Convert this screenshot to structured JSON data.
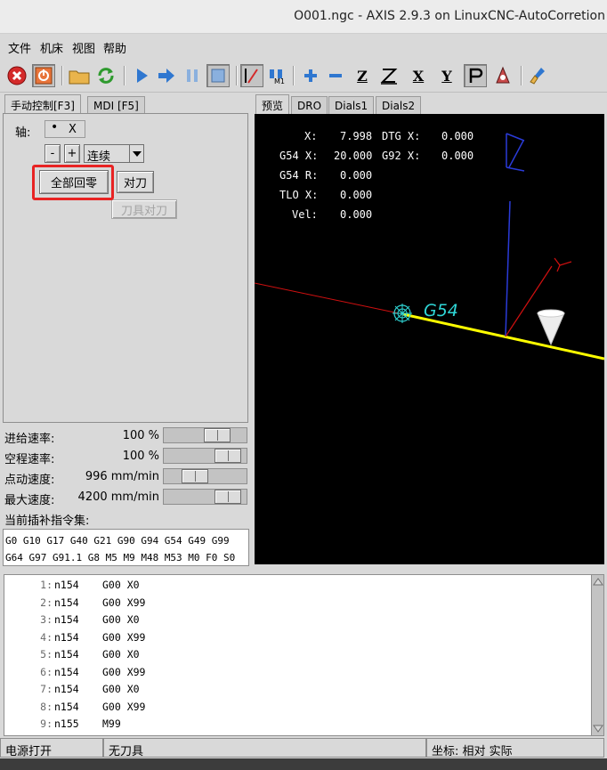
{
  "window": {
    "title": "O001.ngc - AXIS 2.9.3 on LinuxCNC-AutoCorretion"
  },
  "menu": {
    "file": "文件",
    "machine": "机床",
    "view": "视图",
    "help": "帮助"
  },
  "toolbar": {
    "axis_x": "X",
    "axis_y": "Y",
    "axis_z": "Z"
  },
  "left_tabs": {
    "manual": "手动控制[F3]",
    "mdi": "MDI [F5]"
  },
  "manual": {
    "axis_label": "轴:",
    "axis_value": "X",
    "minus": "-",
    "plus": "+",
    "jog_mode": "连续",
    "home_all": "全部回零",
    "touch_off": "对刀",
    "tool_touch_off": "刀具对刀"
  },
  "overrides": [
    {
      "label": "进给速率:",
      "value": "100 %",
      "level": 0.72
    },
    {
      "label": "空程速率:",
      "value": "100 %",
      "level": 0.9
    },
    {
      "label": "点动速度:",
      "value": "996 mm/min",
      "level": 0.32
    },
    {
      "label": "最大速度:",
      "value": "4200 mm/min",
      "level": 0.9
    }
  ],
  "active_gcodes": {
    "label": "当前插补指令集:",
    "line1": "G0 G10 G17 G40 G21 G90 G94 G54 G49 G99",
    "line2": "G64 G97 G91.1 G8 M5 M9 M48 M53 M0 F0 S0"
  },
  "preview_tabs": {
    "preview": "预览",
    "dro": "DRO",
    "dials1": "Dials1",
    "dials2": "Dials2"
  },
  "dro": {
    "row1_label": "X:",
    "row1_value": "7.998",
    "row1_dtg_label": "DTG X:",
    "row1_dtg_value": "0.000",
    "row2_label": "G54 X:",
    "row2_value": "20.000",
    "row2_g92_label": "G92 X:",
    "row2_g92_value": "0.000",
    "row3_label": "G54 R:",
    "row3_value": "0.000",
    "row4_label": "TLO X:",
    "row4_value": "0.000",
    "row5_label": "Vel:",
    "row5_value": "0.000"
  },
  "scene": {
    "z_label": "Z",
    "y_label": "Y",
    "origin_label": "G54"
  },
  "program": {
    "lines": [
      {
        "num": "1:",
        "code": "n154",
        "cmd": "G00 X0"
      },
      {
        "num": "2:",
        "code": "n154",
        "cmd": "G00 X99"
      },
      {
        "num": "3:",
        "code": "n154",
        "cmd": "G00 X0"
      },
      {
        "num": "4:",
        "code": "n154",
        "cmd": "G00 X99"
      },
      {
        "num": "5:",
        "code": "n154",
        "cmd": "G00 X0"
      },
      {
        "num": "6:",
        "code": "n154",
        "cmd": "G00 X99"
      },
      {
        "num": "7:",
        "code": "n154",
        "cmd": "G00 X0"
      },
      {
        "num": "8:",
        "code": "n154",
        "cmd": "G00 X99"
      },
      {
        "num": "9:",
        "code": "n155",
        "cmd": "M99"
      }
    ]
  },
  "status": {
    "power": "电源打开",
    "tool": "无刀具",
    "coords": "坐标: 相对 实际"
  },
  "colors": {
    "highlight": "#e82323",
    "path": "#ffff00",
    "axis_x": "#d01010",
    "axis_z": "#2a3bd8",
    "dro_text": "#ffffff",
    "origin": "#2fd6d6"
  }
}
